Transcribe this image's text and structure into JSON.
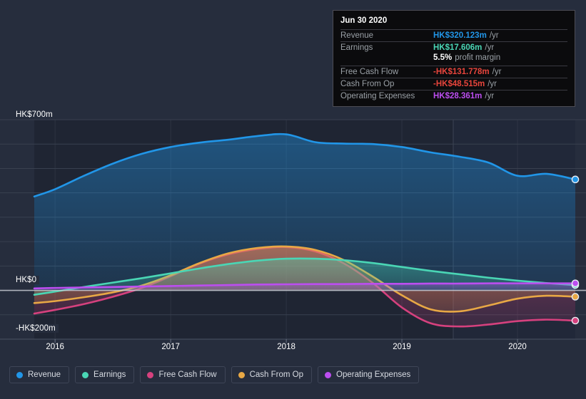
{
  "chart_data": {
    "type": "area",
    "title": "",
    "xlabel": "",
    "ylabel": "HK$",
    "currency": "HK$",
    "ylim": [
      -200,
      700
    ],
    "grid": true,
    "legend_position": "bottom-left",
    "y_ticks": [
      "HK$700m",
      "HK$0",
      "-HK$200m"
    ],
    "y_tick_values": [
      700,
      0,
      -200
    ],
    "x_ticks": [
      "2016",
      "2017",
      "2018",
      "2019",
      "2020"
    ],
    "x_tick_values": [
      2016,
      2017,
      2018,
      2019,
      2020
    ],
    "units": "HK$ millions",
    "series": [
      {
        "name": "Revenue",
        "color": "#2196e8",
        "x": [
          2015.82,
          2016.0,
          2016.25,
          2016.5,
          2016.75,
          2017.0,
          2017.25,
          2017.5,
          2017.75,
          2018.0,
          2018.25,
          2018.5,
          2018.75,
          2019.0,
          2019.25,
          2019.5,
          2019.75,
          2020.0,
          2020.25,
          2020.5
        ],
        "values": [
          385,
          415,
          470,
          520,
          560,
          588,
          606,
          618,
          633,
          640,
          608,
          602,
          600,
          588,
          566,
          548,
          524,
          470,
          478,
          455,
          320.123
        ]
      },
      {
        "name": "Earnings",
        "color": "#4ad6b5",
        "x": [
          2015.82,
          2016.0,
          2016.25,
          2016.5,
          2016.75,
          2017.0,
          2017.25,
          2017.5,
          2017.75,
          2018.0,
          2018.25,
          2018.5,
          2018.75,
          2019.0,
          2019.25,
          2019.5,
          2019.75,
          2020.0,
          2020.25,
          2020.5
        ],
        "values": [
          -18,
          -5,
          14,
          32,
          50,
          70,
          90,
          108,
          122,
          130,
          130,
          124,
          112,
          96,
          80,
          66,
          52,
          40,
          30,
          22,
          17.606
        ]
      },
      {
        "name": "Free Cash Flow",
        "color": "#d6417e",
        "x": [
          2015.82,
          2016.0,
          2016.25,
          2016.5,
          2016.75,
          2017.0,
          2017.25,
          2017.5,
          2017.75,
          2018.0,
          2018.25,
          2018.5,
          2018.75,
          2019.0,
          2019.25,
          2019.5,
          2019.75,
          2020.0,
          2020.25,
          2020.5
        ],
        "values": [
          -95,
          -80,
          -56,
          -26,
          10,
          58,
          110,
          148,
          170,
          178,
          160,
          110,
          30,
          -70,
          -135,
          -148,
          -140,
          -126,
          -120,
          -124,
          -131.778
        ]
      },
      {
        "name": "Cash From Op",
        "color": "#e8a845",
        "x": [
          2015.82,
          2016.0,
          2016.25,
          2016.5,
          2016.75,
          2017.0,
          2017.25,
          2017.5,
          2017.75,
          2018.0,
          2018.25,
          2018.5,
          2018.75,
          2019.0,
          2019.25,
          2019.5,
          2019.75,
          2020.0,
          2020.25,
          2020.5
        ],
        "values": [
          -52,
          -44,
          -28,
          -8,
          20,
          62,
          112,
          152,
          174,
          180,
          166,
          124,
          56,
          -20,
          -78,
          -86,
          -62,
          -34,
          -22,
          -26,
          -48.515
        ]
      },
      {
        "name": "Operating Expenses",
        "color": "#bc4ef0",
        "x": [
          2015.82,
          2016.0,
          2016.25,
          2016.5,
          2016.75,
          2017.0,
          2017.25,
          2017.5,
          2017.75,
          2018.0,
          2018.25,
          2018.5,
          2018.75,
          2019.0,
          2019.25,
          2019.5,
          2019.75,
          2020.0,
          2020.25,
          2020.5
        ],
        "values": [
          8,
          10,
          12,
          14,
          16,
          18,
          20,
          22,
          24,
          25,
          26,
          26,
          27,
          27,
          28,
          28,
          29,
          29,
          29,
          29,
          28.361
        ]
      }
    ]
  },
  "axis": {
    "y_top_label": "HK$700m",
    "y_zero_label": "HK$0",
    "y_bottom_label": "-HK$200m",
    "x_labels": [
      "2016",
      "2017",
      "2018",
      "2019",
      "2020"
    ]
  },
  "tooltip": {
    "date": "Jun 30 2020",
    "rows": [
      {
        "label": "Revenue",
        "value": "HK$320.123m",
        "unit": "/yr",
        "color": "#2196e8"
      },
      {
        "label": "Earnings",
        "value": "HK$17.606m",
        "unit": "/yr",
        "color": "#4ad6b5"
      },
      {
        "label": "",
        "value": "5.5%",
        "sub": "profit margin",
        "color": "#ffffff"
      },
      {
        "label": "Free Cash Flow",
        "value": "-HK$131.778m",
        "unit": "/yr",
        "color": "#e8453c"
      },
      {
        "label": "Cash From Op",
        "value": "-HK$48.515m",
        "unit": "/yr",
        "color": "#e8453c"
      },
      {
        "label": "Operating Expenses",
        "value": "HK$28.361m",
        "unit": "/yr",
        "color": "#bc4ef0"
      }
    ]
  },
  "legend": {
    "items": [
      {
        "label": "Revenue",
        "color": "#2196e8"
      },
      {
        "label": "Earnings",
        "color": "#4ad6b5"
      },
      {
        "label": "Free Cash Flow",
        "color": "#d6417e"
      },
      {
        "label": "Cash From Op",
        "color": "#e8a845"
      },
      {
        "label": "Operating Expenses",
        "color": "#bc4ef0"
      }
    ]
  },
  "colors": {
    "page_background": "#262d3d",
    "plot_background": "#1f2533",
    "plot_background_future": "#212839",
    "gridline": "#39404f",
    "zero_line": "#c8ccd4",
    "tooltip_background": "#0b0b0d",
    "tooltip_border": "#4c4c55"
  }
}
